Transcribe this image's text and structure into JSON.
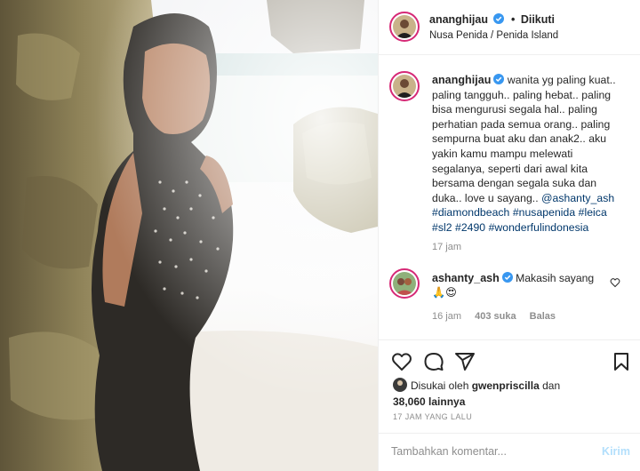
{
  "post": {
    "username": "ananghijau",
    "follow_status": "Diikuti",
    "location": "Nusa Penida / Penida Island",
    "caption": {
      "text_lines": [
        "wanita yg paling kuat..",
        "paling tangguh.. paling hebat.. paling",
        "bisa mengurusi segala hal.. paling",
        "perhatian pada semua orang.. paling",
        "sempurna buat aku dan anak2.. aku",
        "yakin kamu mampu melewati",
        "segalanya, seperti dari awal kita",
        "bersama dengan segala suka dan",
        "duka.. love u sayang.."
      ],
      "mention": "@ashanty_ash",
      "hashtags_line1": [
        "#diamondbeach",
        "#nusapenida",
        "#leica"
      ],
      "hashtags_line2": [
        "#sl2",
        "#2490",
        "#wonderfulindonesia"
      ],
      "time": "17 jam"
    },
    "comment": {
      "username": "ashanty_ash",
      "text": "Makasih sayang",
      "emojis": "🙏😍",
      "time": "16 jam",
      "likes": "403 suka",
      "reply_label": "Balas"
    },
    "likes": {
      "prefix": "Disukai oleh",
      "user": "gwenpriscilla",
      "conj": "dan",
      "count": "38,060 lainnya"
    },
    "posted_ago": "17 JAM YANG LALU",
    "comment_input": {
      "placeholder": "Tambahkan komentar...",
      "send_label": "Kirim"
    }
  },
  "icons": {
    "verified": "verified-badge-icon",
    "like": "heart-icon",
    "comment": "comment-icon",
    "share": "paper-plane-icon",
    "save": "bookmark-icon"
  },
  "colors": {
    "link": "#00376b",
    "verified": "#3897f0",
    "muted": "#8e8e8e",
    "story_ring": "#d62976",
    "send_disabled": "#b2dffc"
  }
}
